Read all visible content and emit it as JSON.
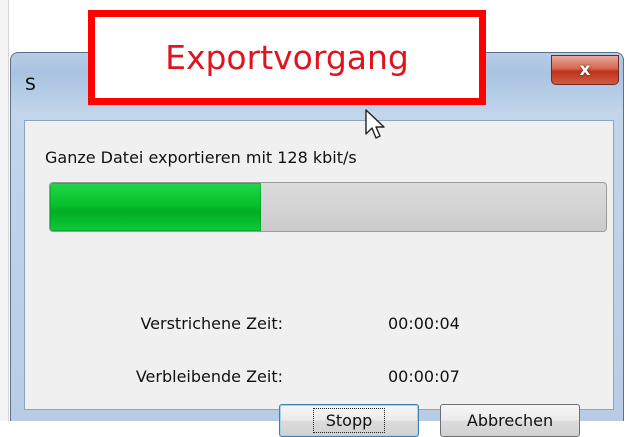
{
  "callout": {
    "text": "Exportvorgang"
  },
  "window": {
    "title": "S",
    "close_label": "x"
  },
  "dialog": {
    "info": "Ganze Datei exportieren mit 128 kbit/s",
    "progress": {
      "percent": 38,
      "color": "#06c02d"
    },
    "elapsed": {
      "label": "Verstrichene Zeit:",
      "value": "00:00:04"
    },
    "remaining": {
      "label": "Verbleibende Zeit:",
      "value": "00:00:07"
    },
    "buttons": {
      "stop": "Stopp",
      "cancel": "Abbrechen"
    }
  },
  "icons": {
    "cursor": "mouse-pointer-icon",
    "close": "close-icon"
  }
}
